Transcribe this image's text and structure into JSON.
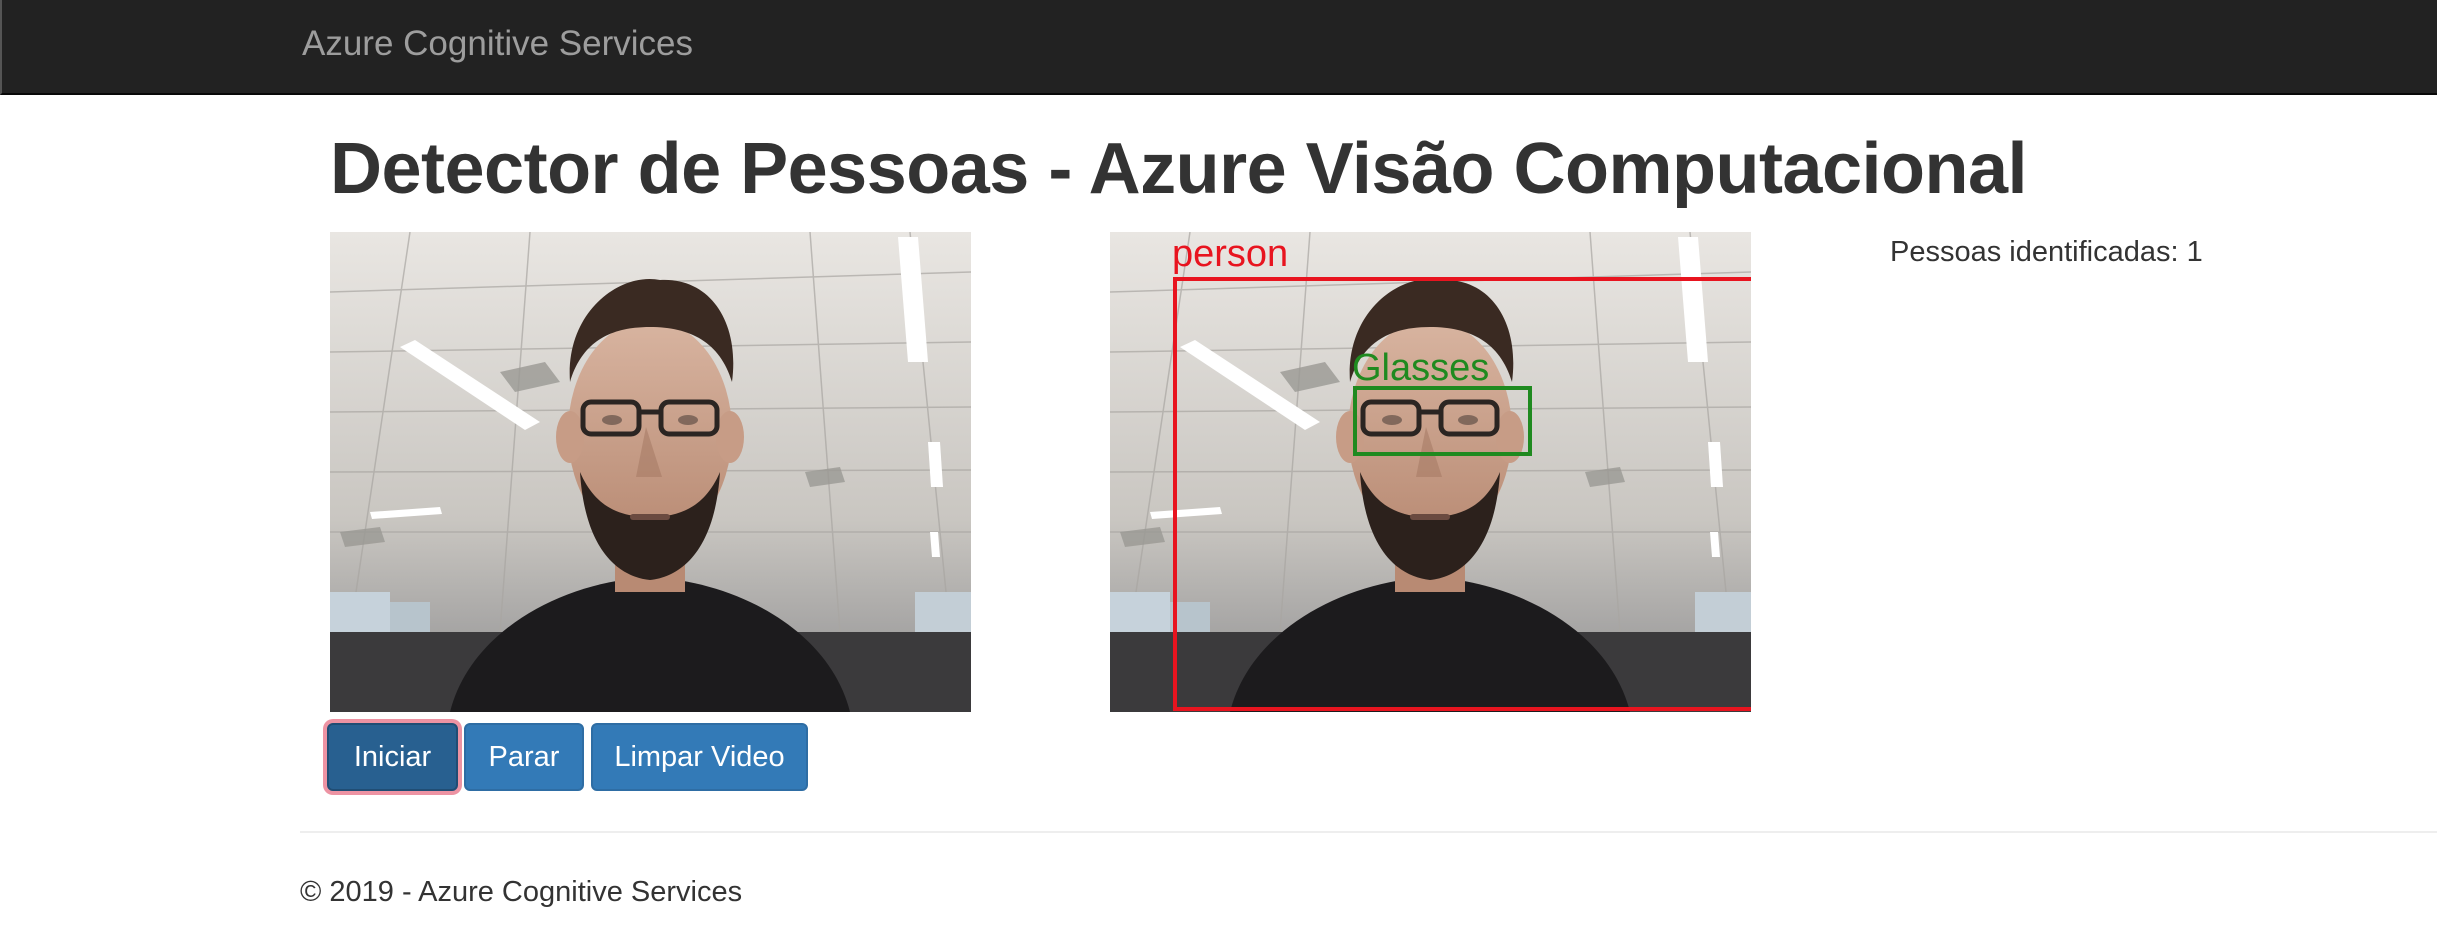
{
  "navbar": {
    "brand": "Azure Cognitive Services"
  },
  "main": {
    "title": "Detector de Pessoas - Azure Visão Computacional",
    "people_count_label": "Pessoas identificadas: 1",
    "detections": {
      "person_label": "person",
      "glasses_label": "Glasses",
      "person_color": "#e8141f",
      "glasses_color": "#1f8a1f"
    },
    "buttons": {
      "start": "Iniciar",
      "stop": "Parar",
      "clear": "Limpar Video"
    }
  },
  "footer": {
    "text": "© 2019 - Azure Cognitive Services"
  },
  "colors": {
    "navbar_bg": "#222222",
    "brand_text": "#9d9d9d",
    "button_primary": "#337ab7",
    "button_active": "#286090"
  }
}
